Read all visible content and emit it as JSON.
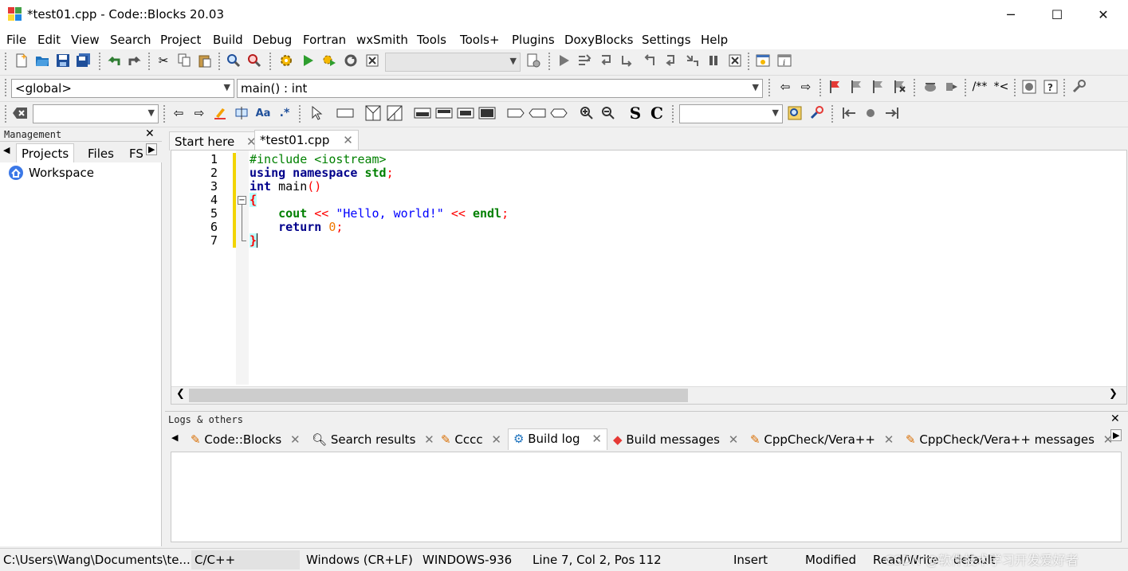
{
  "window": {
    "title": "*test01.cpp - Code::Blocks 20.03",
    "minimize": "─",
    "maximize": "☐",
    "close": "✕"
  },
  "menu": [
    "File",
    "Edit",
    "View",
    "Search",
    "Project",
    "Build",
    "Debug",
    "Fortran",
    "wxSmith",
    "Tools",
    "Tools+",
    "Plugins",
    "DoxyBlocks",
    "Settings",
    "Help"
  ],
  "toolbar2": {
    "scope_value": "<global>",
    "function_value": "main() : int",
    "doxy_comment": "/**",
    "doxy_line": "*<"
  },
  "toolbar3": {
    "regex_label": ".*",
    "case_label": "Aa",
    "s_label": "S",
    "c_label": "C"
  },
  "management": {
    "title": "Management",
    "tabs": [
      "Projects",
      "Files",
      "FS"
    ],
    "workspace": "Workspace"
  },
  "editor": {
    "tabs": [
      "Start here",
      "*test01.cpp"
    ],
    "line_numbers": [
      "1",
      "2",
      "3",
      "4",
      "5",
      "6",
      "7"
    ]
  },
  "logs": {
    "title": "Logs & others",
    "tabs": [
      "Code::Blocks",
      "Search results",
      "Cccc",
      "Build log",
      "Build messages",
      "CppCheck/Vera++",
      "CppCheck/Vera++ messages"
    ]
  },
  "status": {
    "path": "C:\\Users\\Wang\\Documents\\te...",
    "language": "C/C++",
    "line_endings": "Windows (CR+LF)",
    "encoding": "WINDOWS-936",
    "position": "Line 7, Col 2, Pos 112",
    "insert_mode": "Insert",
    "modified": "Modified",
    "read_write": "Read/Write",
    "default": "default"
  },
  "watermark": "CSDN @软件技术学习开发爱好者"
}
